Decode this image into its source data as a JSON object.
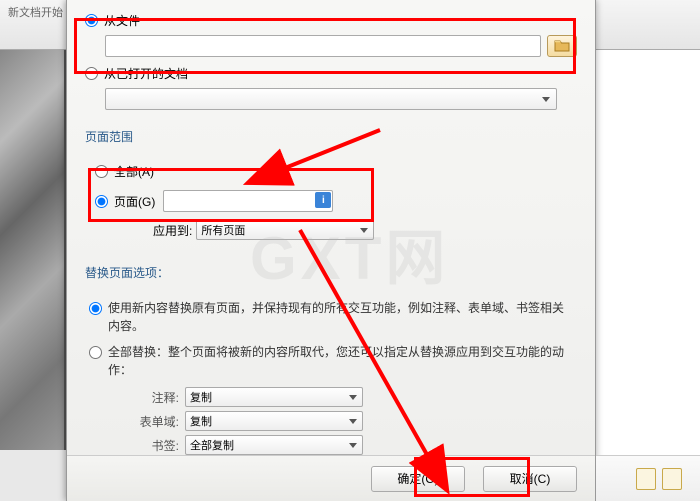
{
  "top": {
    "heading": "新文档开始"
  },
  "source": {
    "from_file_label": "从文件",
    "from_open_doc_label": "从已打开的文档"
  },
  "range": {
    "group_label": "页面范围",
    "all_label": "全部(A)",
    "pages_label": "页面(G)",
    "apply_label": "应用到:",
    "apply_value": "所有页面"
  },
  "replace": {
    "group_label": "替换页面选项：",
    "opt_keep": "使用新内容替换原有页面，并保持现有的所有交互功能，例如注释、表单域、书签相关内容。",
    "opt_full": "全部替换：整个页面将被新的内容所取代，您还可以指定从替换源应用到交互功能的动作：",
    "rows": {
      "annot_label": "注释:",
      "annot_value": "复制",
      "form_label": "表单域:",
      "form_value": "复制",
      "bookmark_label": "书签:",
      "bookmark_value": "全部复制"
    }
  },
  "buttons": {
    "ok": "确定(O)",
    "cancel": "取消(C)"
  },
  "watermark": "GXT网"
}
